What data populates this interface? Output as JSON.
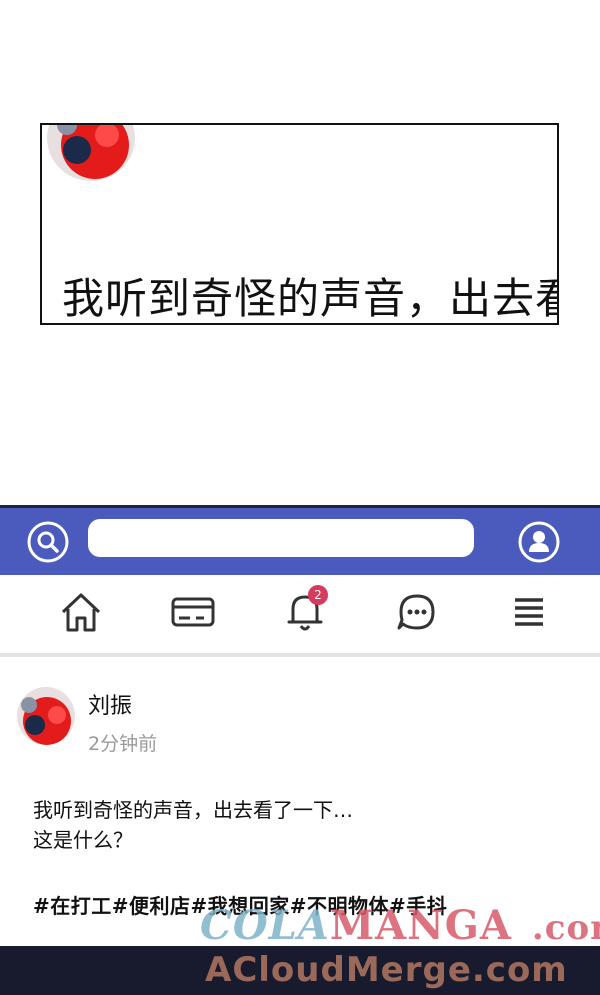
{
  "comic_panel": {
    "caption": "我听到奇怪的声音，出去看"
  },
  "header": {
    "search": {
      "value": "",
      "placeholder": ""
    }
  },
  "nav": {
    "items": [
      {
        "icon": "home-icon"
      },
      {
        "icon": "card-icon"
      },
      {
        "icon": "bell-icon",
        "badge": "2"
      },
      {
        "icon": "chat-icon"
      },
      {
        "icon": "menu-icon"
      }
    ]
  },
  "post": {
    "author": "刘振",
    "time": "2分钟前",
    "body_line1": "我听到奇怪的声音，出去看了一下…",
    "body_line2": "这是什么？",
    "tags": "#在打工#便利店#我想回家#不明物体#手抖"
  },
  "watermark": {
    "part1": "COLA",
    "part2": "MANGA",
    "part3": ".com",
    "line2": "ACloudMerge.com"
  },
  "colors": {
    "header_bg": "#4a5bbd",
    "badge": "#d63a5c",
    "time_text": "#9a9a9a"
  }
}
